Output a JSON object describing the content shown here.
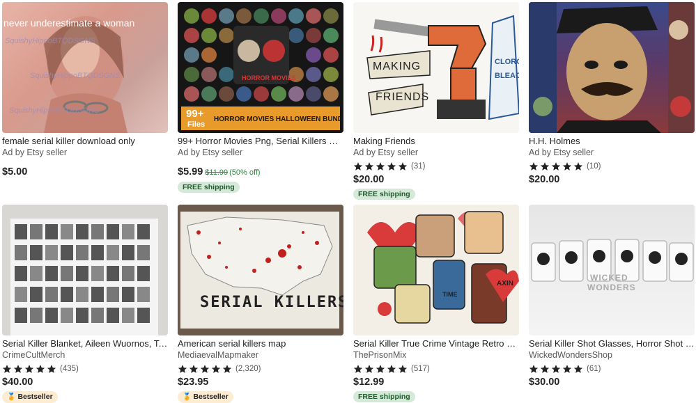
{
  "listings": [
    {
      "title": "female serial killer download only",
      "seller": "Ad by Etsy seller",
      "price": "$5.00",
      "image_text": [
        "never underestimate a woman",
        "SquishyHippoBTQDSGNS"
      ]
    },
    {
      "title": "99+ Horror Movies Png, Serial Killers Png, Jaso...",
      "seller": "Ad by Etsy seller",
      "price": "$5.99",
      "original_price": "$11.99",
      "discount": "(50% off)",
      "badge": "FREE shipping",
      "image_text": [
        "HORROR MOVIES",
        "99+",
        "Files",
        "HORROR MOVIES HALLOWEEN BUNDLE PNG"
      ]
    },
    {
      "title": "Making Friends",
      "seller": "Ad by Etsy seller",
      "rating": 5,
      "review_count": "(31)",
      "price": "$20.00",
      "badge": "FREE shipping",
      "image_text": [
        "MAKING",
        "FRIENDS",
        "CLOROX",
        "BLEACH"
      ]
    },
    {
      "title": "H.H. Holmes",
      "seller": "Ad by Etsy seller",
      "rating": 5,
      "review_count": "(10)",
      "price": "$20.00"
    },
    {
      "title": "Serial Killer Blanket, Aileen Wuornos, Ted Bun...",
      "seller": "CrimeCultMerch",
      "rating": 5,
      "review_count": "(435)",
      "price": "$40.00",
      "badge": "Bestseller"
    },
    {
      "title": "American serial killers map",
      "seller": "MediaevalMapmaker",
      "rating": 5,
      "review_count": "(2,320)",
      "price": "$23.95",
      "badge": "Bestseller",
      "image_text": [
        "SERIAL KILLERS"
      ]
    },
    {
      "title": "Serial Killer True Crime Vintage Retro Valentin...",
      "seller": "ThePrisonMix",
      "rating": 5,
      "review_count": "(517)",
      "price": "$12.99",
      "badge": "FREE shipping",
      "image_text": [
        "TIME",
        "AXIN"
      ]
    },
    {
      "title": "Serial Killer Shot Glasses, Horror Shot glasses",
      "seller": "WickedWondersShop",
      "rating": 5,
      "review_count": "(61)",
      "price": "$30.00",
      "image_text": [
        "WICKED",
        "WONDERS"
      ]
    }
  ],
  "colors": {
    "star": "#222222",
    "free_shipping_bg": "#d4e9d7",
    "bestseller_bg": "#fdebd2",
    "sale_green": "#2a8a3e"
  },
  "icons": [
    "star-icon",
    "bestseller-medal-icon"
  ]
}
